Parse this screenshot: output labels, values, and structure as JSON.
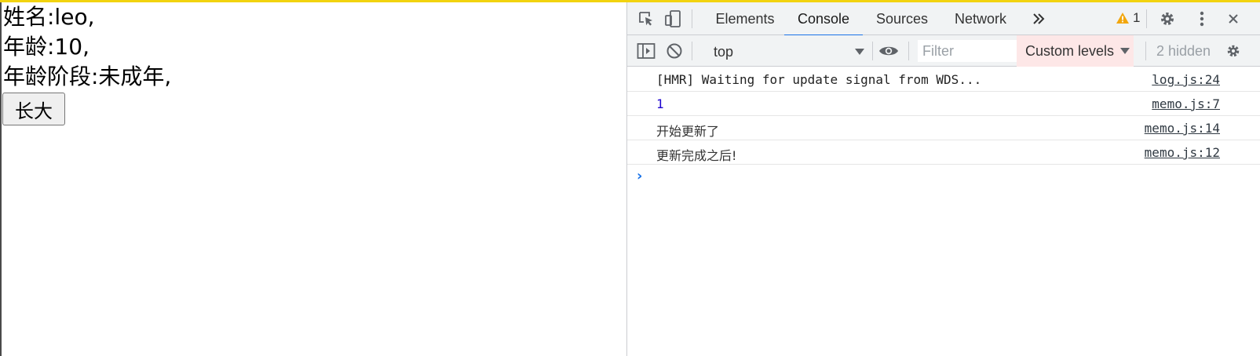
{
  "page": {
    "lines": [
      "姓名:leo,",
      "年龄:10,",
      "年龄阶段:未成年,"
    ],
    "grow_button": "长大"
  },
  "devtools": {
    "tabs": [
      {
        "label": "Elements",
        "active": false
      },
      {
        "label": "Console",
        "active": true
      },
      {
        "label": "Sources",
        "active": false
      },
      {
        "label": "Network",
        "active": false
      }
    ],
    "more_tabs_icon": "double-chevron-icon",
    "warning_count": "1",
    "toolbar": {
      "context": "top",
      "filter_placeholder": "Filter",
      "levels_label": "Custom levels",
      "hidden_label": "2 hidden"
    },
    "console": [
      {
        "message": "[HMR] Waiting for update signal from WDS...",
        "source": "log.js:24",
        "kind": "text"
      },
      {
        "message": "1",
        "source": "memo.js:7",
        "kind": "number"
      },
      {
        "message": "开始更新了",
        "source": "memo.js:14",
        "kind": "cjk"
      },
      {
        "message": "更新完成之后!",
        "source": "memo.js:12",
        "kind": "cjk"
      }
    ],
    "colors": {
      "accent": "#1a73e8",
      "warning": "#f2a60c",
      "levels_bg": "#fde7e7"
    }
  }
}
